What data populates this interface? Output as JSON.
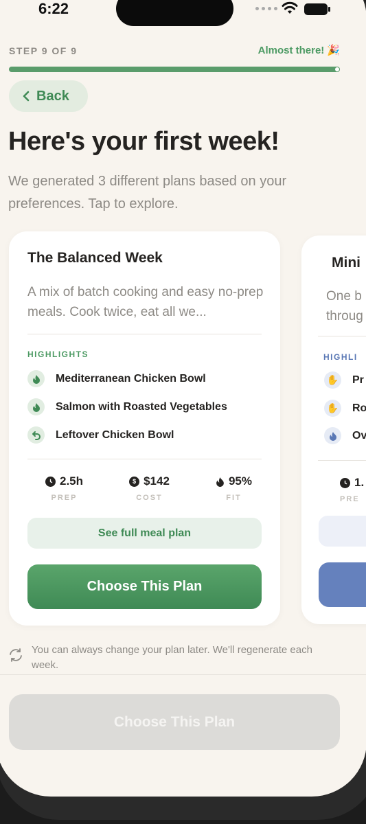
{
  "status_bar": {
    "time": "6:22"
  },
  "progress": {
    "step_label": "STEP 9 OF 9",
    "message": "Almost there!",
    "emoji": "🎉",
    "fraction": 1.0
  },
  "nav": {
    "back_label": "Back"
  },
  "header": {
    "title": "Here's your first week!",
    "subtitle": "We generated 3 different plans based on your preferences. Tap to explore."
  },
  "plans": [
    {
      "title": "The Balanced Week",
      "description": "A mix of batch cooking and easy no-prep meals. Cook twice, eat all we...",
      "highlights_label": "HIGHLIGHTS",
      "highlights": [
        {
          "icon": "flame-icon",
          "text": "Mediterranean Chicken Bowl"
        },
        {
          "icon": "flame-icon",
          "text": "Salmon with Roasted Vegetables"
        },
        {
          "icon": "leftover-arrow-icon",
          "text": "Leftover Chicken Bowl"
        }
      ],
      "stats": [
        {
          "icon": "clock-icon",
          "value": "2.5h",
          "label": "PREP"
        },
        {
          "icon": "dollar-icon",
          "value": "$142",
          "label": "COST"
        },
        {
          "icon": "flame-icon",
          "value": "95%",
          "label": "FIT"
        }
      ],
      "see_plan_label": "See full meal plan",
      "choose_label": "Choose This Plan",
      "accent": "#3f8a55"
    },
    {
      "title": "Mini",
      "description": "One b throug",
      "highlights_label": "HIGHLI",
      "highlights": [
        {
          "icon": "hand-icon",
          "text": "Pr"
        },
        {
          "icon": "hand-icon",
          "text": "Ro"
        },
        {
          "icon": "flame-icon",
          "text": "Ov"
        }
      ],
      "stats": [
        {
          "icon": "clock-icon",
          "value": "1.",
          "label": "PRE"
        }
      ],
      "accent": "#6581bd"
    }
  ],
  "footer": {
    "note": "You can always change your plan later. We'll regenerate each week.",
    "primary_label": "Choose This Plan"
  }
}
